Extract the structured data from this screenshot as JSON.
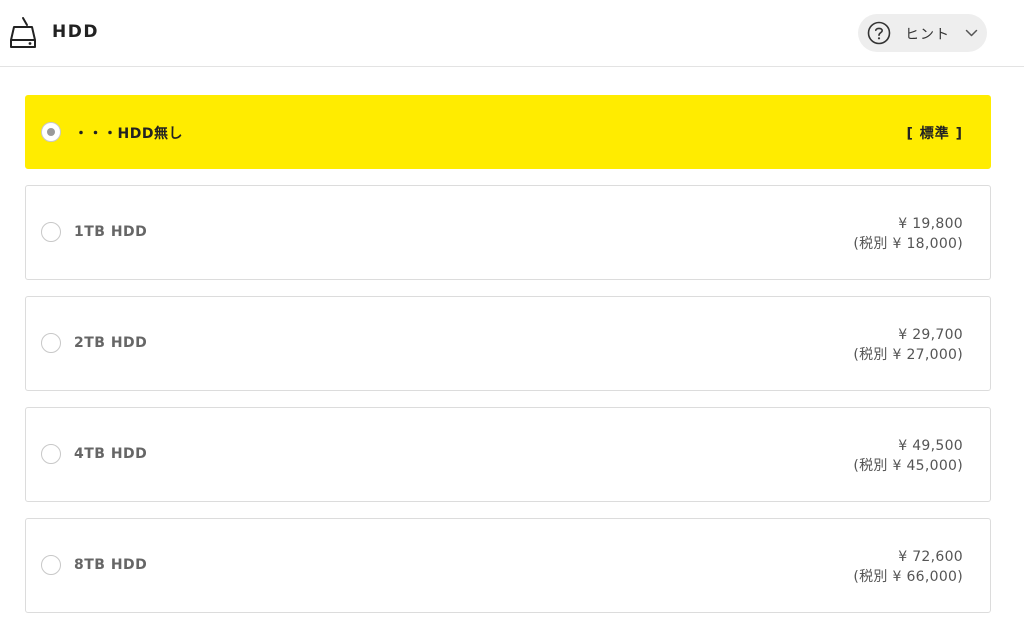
{
  "header": {
    "title": "HDD",
    "hint_label": "ヒント",
    "icon": "hdd-icon"
  },
  "options": [
    {
      "label": "・・・HDD無し",
      "standard": "[ 標準 ]",
      "selected": true
    },
    {
      "label": "1TB HDD",
      "price": "¥ 19,800",
      "price_ex_tax": "(税別 ¥ 18,000)",
      "selected": false
    },
    {
      "label": "2TB HDD",
      "price": "¥ 29,700",
      "price_ex_tax": "(税別 ¥ 27,000)",
      "selected": false
    },
    {
      "label": "4TB HDD",
      "price": "¥ 49,500",
      "price_ex_tax": "(税別 ¥ 45,000)",
      "selected": false
    },
    {
      "label": "8TB HDD",
      "price": "¥ 72,600",
      "price_ex_tax": "(税別 ¥ 66,000)",
      "selected": false
    }
  ],
  "colors": {
    "selected_bg": "#ffec00",
    "border": "#dcdcdc",
    "hint_bg": "#eeeeee"
  }
}
